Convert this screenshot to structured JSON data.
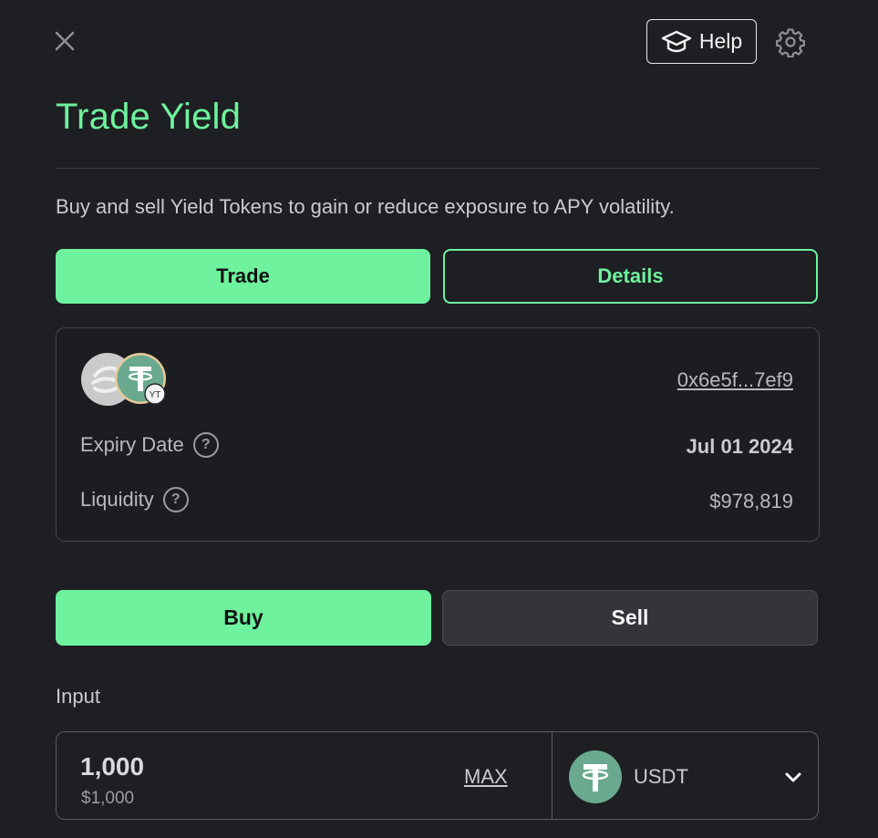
{
  "header": {
    "help_label": "Help",
    "title": "Trade Yield",
    "subtitle": "Buy and sell Yield Tokens to gain or reduce exposure to APY volatility."
  },
  "tabs": [
    {
      "label": "Trade",
      "active": true
    },
    {
      "label": "Details",
      "active": false
    }
  ],
  "pool": {
    "address": "0x6e5f...7ef9",
    "badge": "YT",
    "expiry_label": "Expiry Date",
    "expiry_value": "Jul 01 2024",
    "liquidity_label": "Liquidity",
    "liquidity_value": "$978,819"
  },
  "side": {
    "buy_label": "Buy",
    "sell_label": "Sell",
    "selected": "Buy"
  },
  "input": {
    "label": "Input",
    "amount": "1,000",
    "amount_usd": "$1,000",
    "max_label": "MAX",
    "token": "USDT"
  },
  "colors": {
    "accent": "#6ef29e",
    "background": "#1e1f22",
    "usdt": "#6aa98f"
  },
  "icons": [
    "close-icon",
    "graduation-cap-icon",
    "gear-icon",
    "help-icon",
    "chevron-down-icon",
    "usdt-icon"
  ]
}
